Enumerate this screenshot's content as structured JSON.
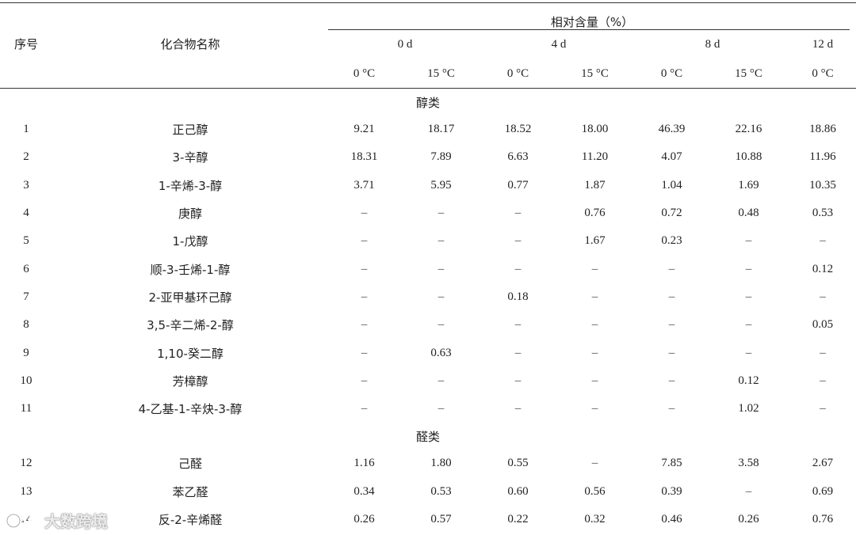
{
  "header": {
    "col_id": "序号",
    "col_name": "化合物名称",
    "relative_content": "相对含量（%）",
    "days": [
      "0 d",
      "4 d",
      "8 d",
      "12 d"
    ],
    "temps": [
      "0 °C",
      "15 °C",
      "0 °C",
      "15 °C",
      "0 °C",
      "15 °C",
      "0 °C"
    ]
  },
  "groups": [
    {
      "label": "醇类",
      "rows": [
        {
          "id": "1",
          "name": "正己醇",
          "values": [
            "9.21",
            "18.17",
            "18.52",
            "18.00",
            "46.39",
            "22.16",
            "18.86"
          ]
        },
        {
          "id": "2",
          "name": "3-辛醇",
          "values": [
            "18.31",
            "7.89",
            "6.63",
            "11.20",
            "4.07",
            "10.88",
            "11.96"
          ]
        },
        {
          "id": "3",
          "name": "1-辛烯-3-醇",
          "values": [
            "3.71",
            "5.95",
            "0.77",
            "1.87",
            "1.04",
            "1.69",
            "10.35"
          ]
        },
        {
          "id": "4",
          "name": "庚醇",
          "values": [
            "–",
            "–",
            "–",
            "0.76",
            "0.72",
            "0.48",
            "0.53"
          ]
        },
        {
          "id": "5",
          "name": "1-戊醇",
          "values": [
            "–",
            "–",
            "–",
            "1.67",
            "0.23",
            "–",
            "–"
          ]
        },
        {
          "id": "6",
          "name": "顺-3-壬烯-1-醇",
          "values": [
            "–",
            "–",
            "–",
            "–",
            "–",
            "–",
            "0.12"
          ]
        },
        {
          "id": "7",
          "name": "2-亚甲基环己醇",
          "values": [
            "–",
            "–",
            "0.18",
            "–",
            "–",
            "–",
            "–"
          ]
        },
        {
          "id": "8",
          "name": "3,5-辛二烯-2-醇",
          "values": [
            "–",
            "–",
            "–",
            "–",
            "–",
            "–",
            "0.05"
          ]
        },
        {
          "id": "9",
          "name": "1,10-癸二醇",
          "values": [
            "–",
            "0.63",
            "–",
            "–",
            "–",
            "–",
            "–"
          ]
        },
        {
          "id": "10",
          "name": "芳樟醇",
          "values": [
            "–",
            "–",
            "–",
            "–",
            "–",
            "0.12",
            "–"
          ]
        },
        {
          "id": "11",
          "name": "4-乙基-1-辛炔-3-醇",
          "values": [
            "–",
            "–",
            "–",
            "–",
            "–",
            "1.02",
            "–"
          ]
        }
      ]
    },
    {
      "label": "醛类",
      "rows": [
        {
          "id": "12",
          "name": "己醛",
          "values": [
            "1.16",
            "1.80",
            "0.55",
            "–",
            "7.85",
            "3.58",
            "2.67"
          ]
        },
        {
          "id": "13",
          "name": "苯乙醛",
          "values": [
            "0.34",
            "0.53",
            "0.60",
            "0.56",
            "0.39",
            "–",
            "0.69"
          ]
        },
        {
          "id": "14",
          "name": "反-2-辛烯醛",
          "values": [
            "0.26",
            "0.57",
            "0.22",
            "0.32",
            "0.46",
            "0.26",
            "0.76"
          ]
        }
      ]
    }
  ],
  "watermark": {
    "text": "大数跨境"
  }
}
